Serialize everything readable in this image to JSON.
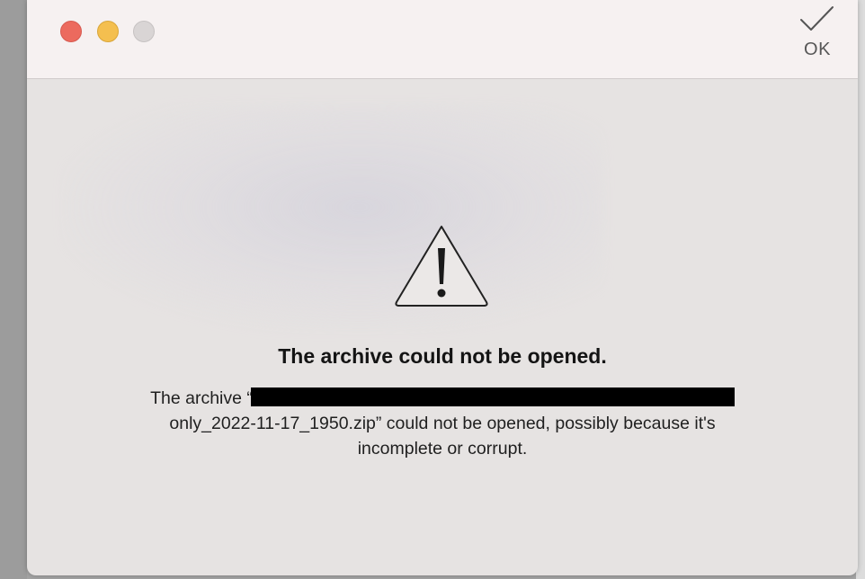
{
  "window": {
    "controls": [
      "close",
      "minimize",
      "zoom"
    ],
    "colors": {
      "close": "#ec6a5e",
      "minimize": "#f4bf4f",
      "zoom": "#d9d5d5"
    }
  },
  "toolbar": {
    "ok_label": "OK",
    "ok_icon": "checkmark-icon"
  },
  "alert": {
    "icon": "warning-triangle-icon",
    "title": "The archive could not be opened.",
    "message_prefix": "The archive “",
    "message_redacted": "[redacted]",
    "message_line2": "only_2022-11-17_1950.zip” could not be opened, possibly because it's",
    "message_line3": "incomplete or corrupt."
  }
}
